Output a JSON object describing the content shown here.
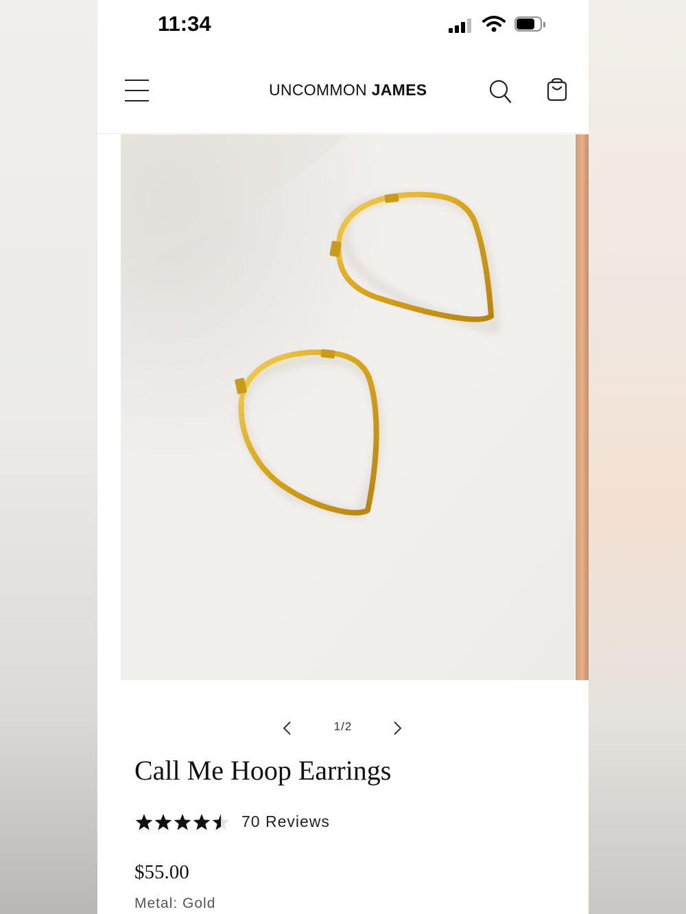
{
  "status_bar": {
    "time": "11:34",
    "icons": [
      "cellular-signal-icon",
      "wifi-icon",
      "battery-icon"
    ]
  },
  "header": {
    "logo_light": "UNCOMMON",
    "logo_bold": "JAMES",
    "icons": [
      "menu-icon",
      "search-icon",
      "shopping-bag-icon"
    ]
  },
  "gallery": {
    "image": "gold teardrop hoop earrings",
    "pager": "1/2",
    "prev_icon": "chevron-left-icon",
    "next_icon": "chevron-right-icon"
  },
  "product": {
    "title": "Call Me Hoop Earrings",
    "rating": 4.5,
    "rating_max": 5,
    "reviews_label": "70 Reviews",
    "price": "$55.00",
    "metal_label": "Metal: Gold"
  },
  "colors": {
    "star_fill": "#111111",
    "star_empty": "#e3e3e3",
    "gold": "#d9a619",
    "photo_background": "#f2f0ed"
  }
}
